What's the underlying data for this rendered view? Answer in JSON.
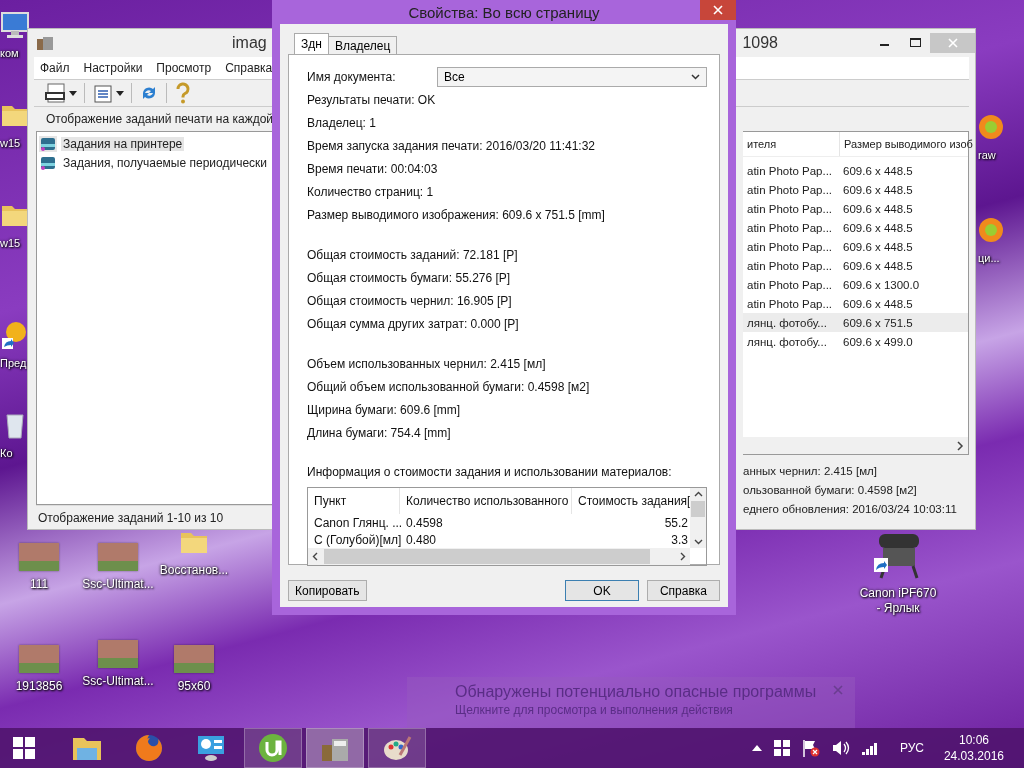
{
  "desktop_icons": [
    {
      "label": "ком",
      "kind": "computer"
    },
    {
      "label": "w15",
      "kind": "folder"
    },
    {
      "label": "w15",
      "kind": "folder"
    },
    {
      "label": "Пред",
      "kind": "shortcut"
    },
    {
      "label": "Ко",
      "kind": "bin"
    },
    {
      "label": "111",
      "kind": "photo"
    },
    {
      "label": "Ssc-Ultimat...",
      "kind": "photo"
    },
    {
      "label": "Восстанов...",
      "kind": "folder"
    },
    {
      "label": "1913856",
      "kind": "photo"
    },
    {
      "label": "Ssc-Ultimat...",
      "kind": "photo"
    },
    {
      "label": "95x60",
      "kind": "photo"
    },
    {
      "label": "raw",
      "kind": "app"
    },
    {
      "label": "ци...",
      "kind": "app"
    },
    {
      "label": "Canon iPF670 - Ярлык",
      "kind": "printer"
    }
  ],
  "main_window": {
    "title_start": "imag",
    "title_end": "1098",
    "menu": [
      "Файл",
      "Настройки",
      "Просмотр",
      "Справка"
    ],
    "view_label": "Отображение заданий печати на каждой",
    "tree": [
      {
        "label": "Задания на принтере",
        "selected": true
      },
      {
        "label": "Задания, получаемые периодически",
        "selected": false
      }
    ],
    "status_bar": "Отображение заданий 1-10 из 10",
    "list": {
      "columns": [
        "ителя",
        "Размер выводимого изоб"
      ],
      "rows": [
        {
          "column_1": "atin Photo Pap...",
          "column_2": "609.6 x 448.5",
          "selected": false
        },
        {
          "column_1": "atin Photo Pap...",
          "column_2": "609.6 x 448.5",
          "selected": false
        },
        {
          "column_1": "atin Photo Pap...",
          "column_2": "609.6 x 448.5",
          "selected": false
        },
        {
          "column_1": "atin Photo Pap...",
          "column_2": "609.6 x 448.5",
          "selected": false
        },
        {
          "column_1": "atin Photo Pap...",
          "column_2": "609.6 x 448.5",
          "selected": false
        },
        {
          "column_1": "atin Photo Pap...",
          "column_2": "609.6 x 448.5",
          "selected": false
        },
        {
          "column_1": "atin Photo Pap...",
          "column_2": "609.6 x 1300.0",
          "selected": false
        },
        {
          "column_1": "atin Photo Pap...",
          "column_2": "609.6 x 448.5",
          "selected": false
        },
        {
          "column_1": "лянц. фотобу...",
          "column_2": "609.6 x 751.5",
          "selected": true
        },
        {
          "column_1": "лянц. фотобу...",
          "column_2": "609.6 x 499.0",
          "selected": false
        }
      ]
    },
    "summary": [
      "анных чернил: 2.415 [мл]",
      "ользованной бумаги: 0.4598 [м2]",
      "еднего обновления: 2016/03/24 10:03:11"
    ]
  },
  "dialog": {
    "title": "Свойства: Во всю страницу",
    "tabs": [
      {
        "label": "Здн",
        "selected": true
      },
      {
        "label": "Владелец",
        "selected": false
      }
    ],
    "field_groups": [
      [
        {
          "kind": "dropdown",
          "label": "Имя документа:",
          "value": "Все"
        },
        {
          "kind": "text",
          "text": "Результаты печати: OK"
        },
        {
          "kind": "text",
          "text": "Владелец: 1"
        },
        {
          "kind": "text",
          "text": "Время запуска задания печати: 2016/03/20 11:41:32"
        },
        {
          "kind": "text",
          "text": "Время печати: 00:04:03"
        },
        {
          "kind": "text",
          "text": "Количество страниц: 1"
        },
        {
          "kind": "text",
          "text": "Размер выводимого изображения: 609.6 x 751.5 [mm]"
        }
      ],
      [
        {
          "kind": "text",
          "text": "Общая стоимость заданий: 72.181 [P]"
        },
        {
          "kind": "text",
          "text": "Общая стоимость бумаги: 55.276 [P]"
        },
        {
          "kind": "text",
          "text": "Общая стоимость чернил: 16.905 [P]"
        },
        {
          "kind": "text",
          "text": "Общая сумма других затрат: 0.000 [P]"
        }
      ],
      [
        {
          "kind": "text",
          "text": "Объем использованных чернил: 2.415 [мл]"
        },
        {
          "kind": "text",
          "text": "Общий объем использованной бумаги: 0.4598 [м2]"
        },
        {
          "kind": "text",
          "text": "Щирина бумаги: 609.6 [mm]"
        },
        {
          "kind": "text",
          "text": "Длина бумаги: 754.4 [mm]"
        }
      ]
    ],
    "table_caption": "Информация о стоимости задания и использовании материалов:",
    "table": {
      "columns": [
        "Пункт",
        "Количество использованного",
        "Стоимость задания["
      ],
      "rows": [
        [
          "Canon Глянц. ...",
          "0.4598",
          "55.2"
        ],
        [
          "C (Голубой)[мл]",
          "0.480",
          "3.3"
        ]
      ]
    },
    "buttons": [
      {
        "label": "Копировать",
        "default": false
      },
      {
        "label": "OK",
        "default": true
      },
      {
        "label": "Справка",
        "default": false
      }
    ]
  },
  "notification": {
    "title": "Обнаружены потенциально опасные программы",
    "message": "Щелкните для просмотра и выполнения действия"
  },
  "taskbar": {
    "apps": [
      {
        "kind": "explorer",
        "open": false,
        "selected": false
      },
      {
        "kind": "firefox",
        "open": false,
        "selected": false
      },
      {
        "kind": "control-panel",
        "open": false,
        "selected": false
      },
      {
        "kind": "utorrent",
        "open": true,
        "selected": false
      },
      {
        "kind": "calculator",
        "open": true,
        "selected": true
      },
      {
        "kind": "paint",
        "open": true,
        "selected": false
      }
    ],
    "language": "РУС",
    "time": "10:06",
    "date": "24.03.2016"
  }
}
